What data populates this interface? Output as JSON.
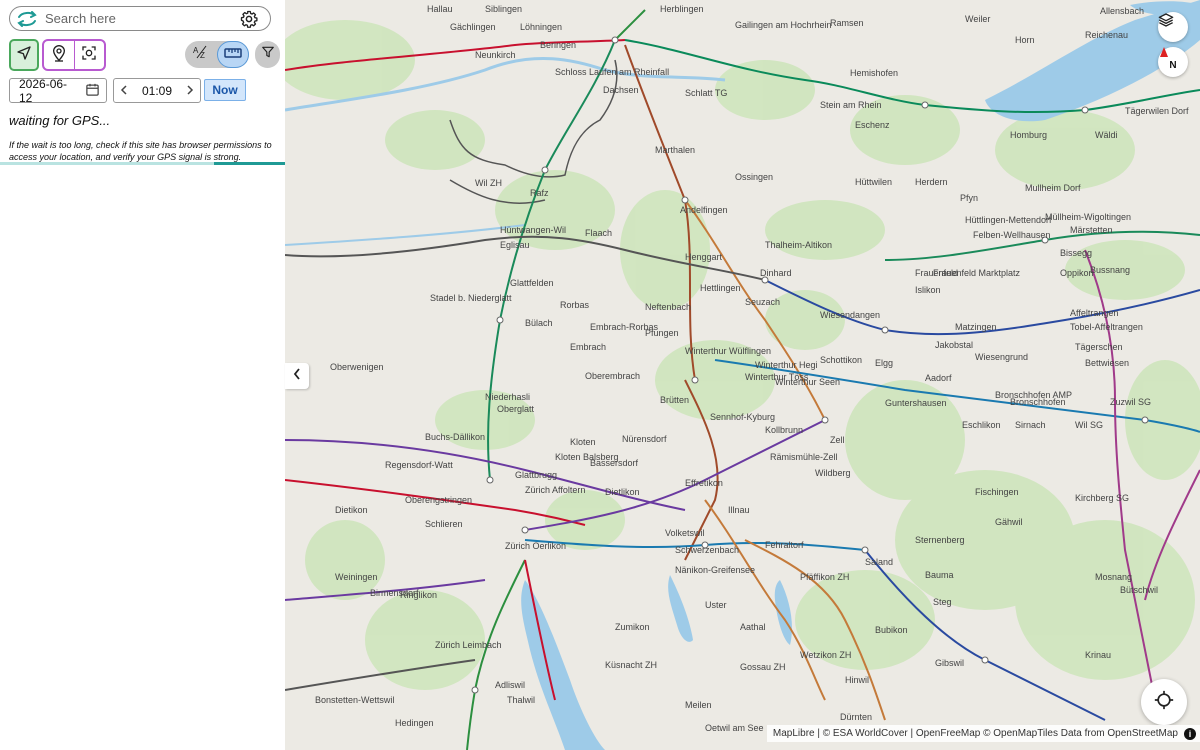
{
  "search": {
    "placeholder": "Search here"
  },
  "date_picker": {
    "value": "2026-06-12"
  },
  "time_picker": {
    "value": "01:09"
  },
  "now_button": {
    "label": "Now"
  },
  "gps_status": {
    "title": "waiting for GPS...",
    "help": "If the wait is too long, check if this site has browser permissions to access your location, and verify your GPS signal is strong."
  },
  "progress": {
    "fraction_start": 0.75,
    "fraction_end": 1.0
  },
  "toggle": {
    "left_label": "A-Z",
    "right_icon": "ruler-icon",
    "active": "right"
  },
  "icons": {
    "logo": "route-arrows-icon",
    "settings": "gear-icon",
    "locate": "navigation-arrow-icon",
    "pin": "map-pin-icon",
    "focus": "focus-frame-icon",
    "filter": "filter-icon",
    "calendar": "calendar-icon",
    "layers": "layers-icon",
    "compass": "compass-icon",
    "gps_target": "crosshair-icon"
  },
  "colors": {
    "accent_green": "#4aa85c",
    "accent_purple": "#b85ad0",
    "now_blue": "#1a56a8",
    "progress_teal": "#1f9a95"
  },
  "map": {
    "compass_label": "N",
    "attribution": "MapLibre | © ESA WorldCover | OpenFreeMap © OpenMapTiles Data from OpenStreetMap",
    "labels": [
      "Siblingen",
      "Gächlingen",
      "Löhningen",
      "Hallau",
      "Neunkirch",
      "Beringen",
      "Herblingen",
      "Gailingen am Hochrhein",
      "Ramsen",
      "Weiler",
      "Horn",
      "Allensbach",
      "Reichenau",
      "Schloss Laufen am Rheinfall",
      "Dachsen",
      "Schlatt TG",
      "Stein am Rhein",
      "Eschenz",
      "Hemishofen",
      "Homburg",
      "Wäldi",
      "Tägerwilen Dorf",
      "Marthalen",
      "Ossingen",
      "Hüttwilen",
      "Herdern",
      "Mullheim Dorf",
      "Pfyn",
      "Wil ZH",
      "Flaach",
      "Andelfingen",
      "Thalheim-Altikon",
      "Hüttlingen-Mettendorf",
      "Müllheim-Wigoltingen",
      "Märstetten",
      "Felben-Wellhausen",
      "Bissegg",
      "Rafz",
      "Hüntwangen-Wil",
      "Eglisau",
      "Glattfelden",
      "Henggart",
      "Dinhard",
      "Frauenfeld",
      "Frauenfeld Marktplatz",
      "Oppikon",
      "Bussnang",
      "Rorbas",
      "Neftenbach",
      "Hettlingen",
      "Seuzach",
      "Islikon",
      "Stadel b. Niederglatt",
      "Bülach",
      "Embrach-Rorbas",
      "Pfungen",
      "Wiesendangen",
      "Affeltrangen",
      "Tobel-Affeltrangen",
      "Embrach",
      "Winterthur Wülflingen",
      "Winterthur Hegi",
      "Schottikon",
      "Elgg",
      "Matzingen",
      "Jakobstal",
      "Wiesengrund",
      "Tägerschen",
      "Bettwiesen",
      "Oberwenigen",
      "Niederhasli",
      "Oberembrach",
      "Winterthur Töss",
      "Winterthur Seen",
      "Aadorf",
      "Guntershausen",
      "Bronschhofen AMP",
      "Bronschhofen",
      "Zuzwil SG",
      "Brütten",
      "Sennhof-Kyburg",
      "Oberglatt",
      "Kollbrunn",
      "Eschlikon",
      "Sirnach",
      "Wil SG",
      "Kloten",
      "Nürensdorf",
      "Kloten Balsberg",
      "Bassersdorf",
      "Zell",
      "Rämismühle-Zell",
      "Wildberg",
      "Regensdorf-Watt",
      "Buchs-Dällikon",
      "Glattbrugg",
      "Zürich Affoltern",
      "Oberengstringen",
      "Dietlikon",
      "Effretikon",
      "Illnau",
      "Fischingen",
      "Kirchberg SG",
      "Gähwil",
      "Volketswil",
      "Zürich Oerlikon",
      "Schwerzenbach",
      "Dietikon",
      "Schlieren",
      "Nänikon-Greifensee",
      "Fehraltorf",
      "Pfäffikon ZH",
      "Saland",
      "Sternenberg",
      "Bauma",
      "Mosnang",
      "Bütschwil",
      "Weiningen",
      "Birmensdorf",
      "Ringlikon",
      "Uster",
      "Aathal",
      "Wetzikon ZH",
      "Bubikon",
      "Steg",
      "Krinau",
      "Zürich Leimbach",
      "Zumikon",
      "Gossau ZH",
      "Hinwil",
      "Gibswil",
      "Adliswil",
      "Küsnacht ZH",
      "Thalwil",
      "Meilen",
      "Oetwil am See",
      "Dürnten",
      "Bonstetten-Wettswil",
      "Hedingen"
    ]
  }
}
